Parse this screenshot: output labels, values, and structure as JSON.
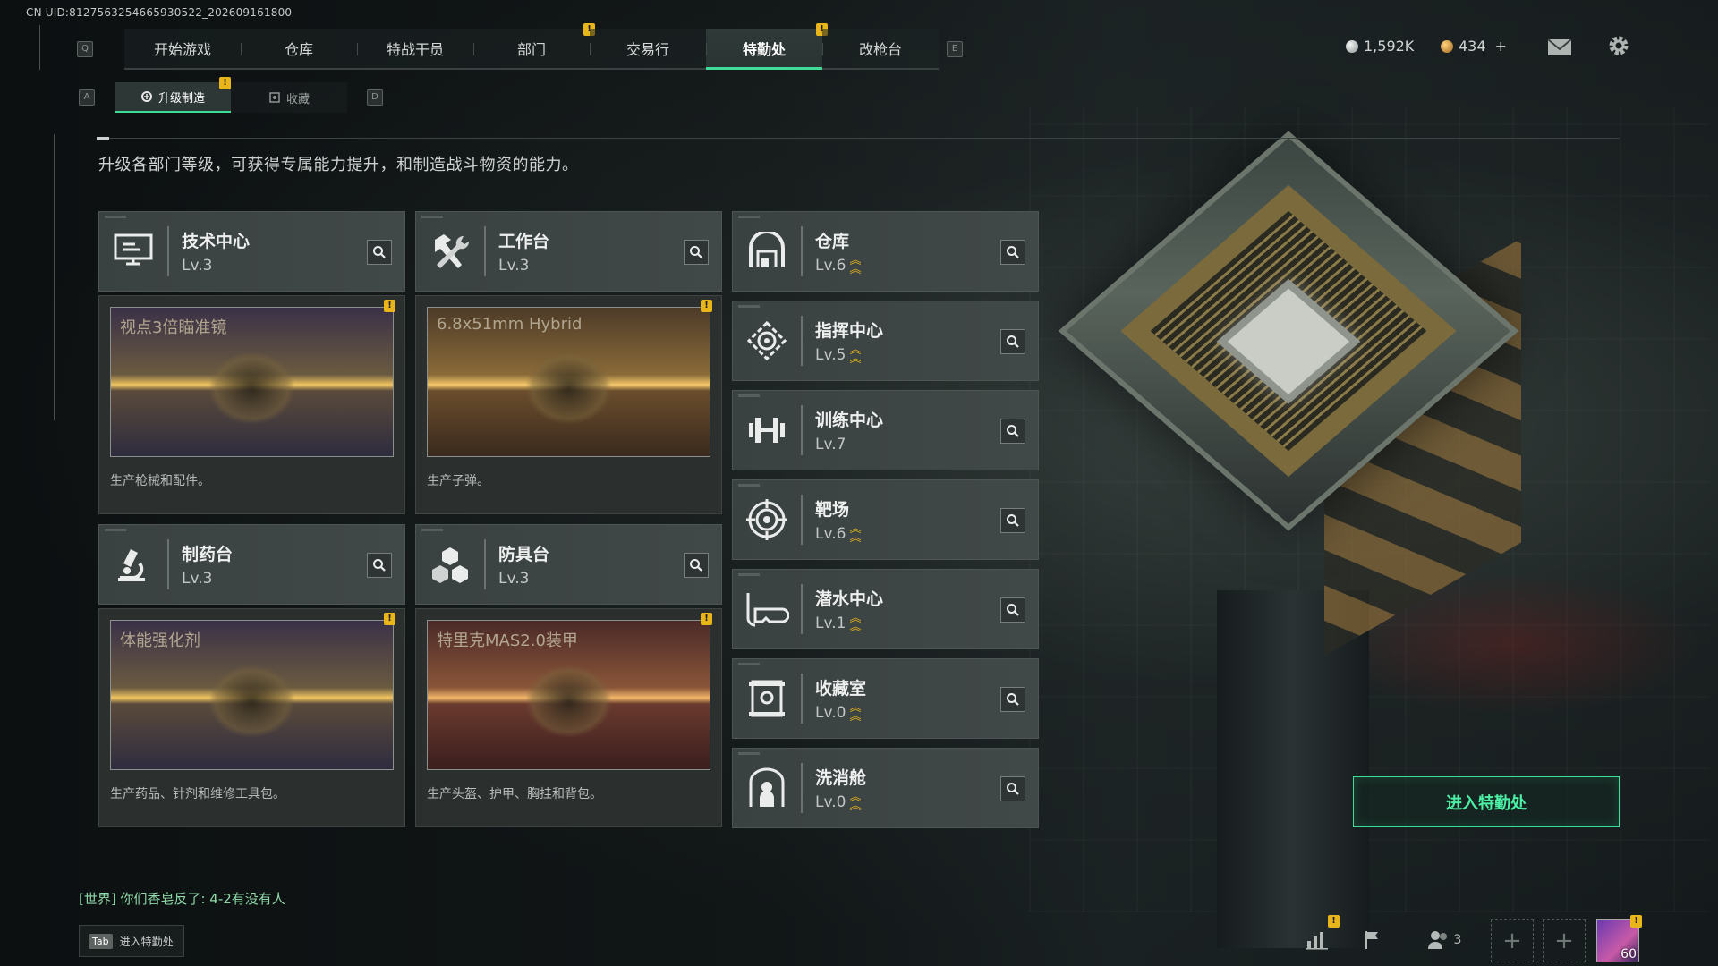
{
  "uid": "CN UID:8127563254665930522_202609161800",
  "top_nav": {
    "left_key": "Q",
    "right_key": "E",
    "tabs": [
      {
        "label": "开始游戏",
        "alert": false
      },
      {
        "label": "仓库",
        "alert": false
      },
      {
        "label": "特战干员",
        "alert": false
      },
      {
        "label": "部门",
        "alert": true
      },
      {
        "label": "交易行",
        "alert": false
      },
      {
        "label": "特勤处",
        "alert": true,
        "active": true
      },
      {
        "label": "改枪台",
        "alert": false
      }
    ]
  },
  "currency": {
    "silver": "1,592K",
    "gold": "434",
    "plus": "+"
  },
  "sub_tabs": {
    "left_key": "A",
    "right_key": "D",
    "tabs": [
      {
        "label": "升级制造",
        "active": true,
        "alert": true
      },
      {
        "label": "收藏",
        "active": false,
        "alert": false
      }
    ]
  },
  "alert_glyph": "!",
  "description": "升级各部门等级，可获得专属能力提升，和制造战斗物资的能力。",
  "production_departments": [
    {
      "name": "技术中心",
      "level": "Lv.3",
      "icon": "computer-icon",
      "item": "视点3倍瞄准镜",
      "item_desc": "生产枪械和配件。",
      "bg": "purple"
    },
    {
      "name": "工作台",
      "level": "Lv.3",
      "icon": "hammer-wrench-icon",
      "item": "6.8x51mm Hybrid",
      "item_desc": "生产子弹。",
      "bg": "brown"
    },
    {
      "name": "制药台",
      "level": "Lv.3",
      "icon": "microscope-icon",
      "item": "体能强化剂",
      "item_desc": "生产药品、针剂和维修工具包。",
      "bg": "purple"
    },
    {
      "name": "防具台",
      "level": "Lv.3",
      "icon": "cubes-icon",
      "item": "特里克MAS2.0装甲",
      "item_desc": "生产头盔、护甲、胸挂和背包。",
      "bg": "red"
    }
  ],
  "other_departments": [
    {
      "name": "仓库",
      "level": "Lv.6",
      "upgradable": true,
      "icon": "warehouse-icon"
    },
    {
      "name": "指挥中心",
      "level": "Lv.5",
      "upgradable": true,
      "icon": "command-icon"
    },
    {
      "name": "训练中心",
      "level": "Lv.7",
      "upgradable": false,
      "icon": "dumbbell-icon"
    },
    {
      "name": "靶场",
      "level": "Lv.6",
      "upgradable": true,
      "icon": "target-icon"
    },
    {
      "name": "潜水中心",
      "level": "Lv.1",
      "upgradable": true,
      "icon": "diving-mask-icon"
    },
    {
      "name": "收藏室",
      "level": "Lv.0",
      "upgradable": true,
      "icon": "display-case-icon"
    },
    {
      "name": "洗消舱",
      "level": "Lv.0",
      "upgradable": true,
      "icon": "decontamination-icon"
    }
  ],
  "enter_button": "进入特勤处",
  "chat": "[世界] 你们香皂反了: 4-2有没有人",
  "tab_hint": {
    "key": "Tab",
    "label": "进入特勤处"
  },
  "bottom": {
    "friends_count": "3",
    "avatar_level": "60"
  }
}
